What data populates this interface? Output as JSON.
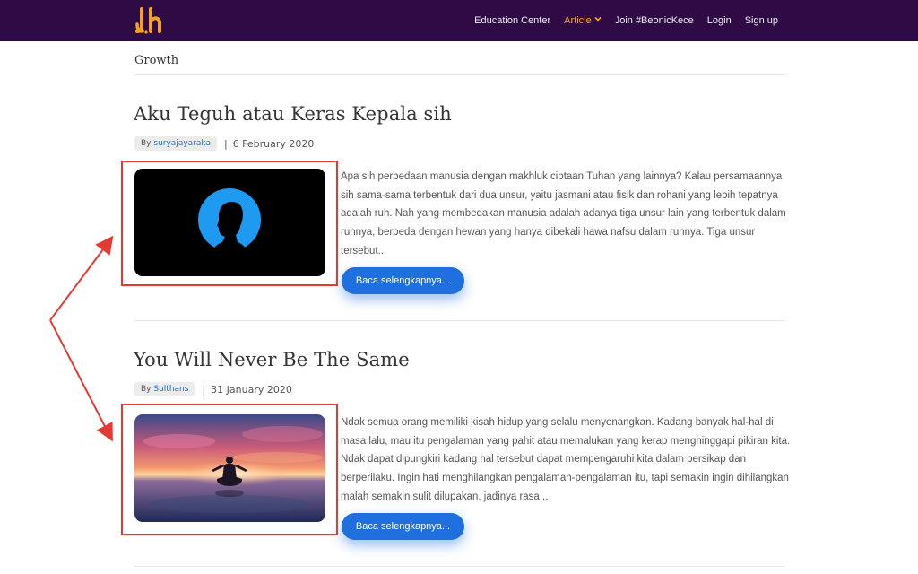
{
  "navbar": {
    "logo_text": "Jh",
    "links": [
      {
        "label": "Education Center"
      },
      {
        "label": "Article"
      },
      {
        "label": "Join #BeonicKece"
      },
      {
        "label": "Login"
      },
      {
        "label": "Sign up"
      }
    ],
    "colors": {
      "background": "#2f0b45",
      "active": "#f6a21e"
    }
  },
  "category": "Growth",
  "posts": [
    {
      "title": "Aku Teguh atau Keras Kepala sih",
      "by_label": "By",
      "author": "suryajayaraka",
      "separator": "|",
      "date": "6 February 2020",
      "image_icon": "person-silhouette-icon",
      "excerpt": "Apa sih perbedaan manusia dengan makhluk ciptaan Tuhan yang lainnya? Kalau persamaannya sih sama-sama terbentuk dari dua unsur, yaitu jasmani atau fisik dan rohani yang lebih tepatnya adalah ruh. Nah yang membedakan manusia adalah adanya tiga unsur lain yang terbentuk dalam ruhnya, berbeda dengan hewan yang hanya dibekali hawa nafsu dalam ruhnya. Tiga unsur tersebut...",
      "button_label": "Baca selengkapnya..."
    },
    {
      "title": "You Will Never Be The Same",
      "by_label": "By",
      "author": "Sulthans",
      "separator": "|",
      "date": "31 January 2020",
      "image_icon": "meditation-sunset-icon",
      "excerpt": "Ndak semua orang memiliki kisah hidup yang selalu menyenangkan. Kadang banyak hal-hal di masa lalu, mau itu pengalaman yang pahit atau memalukan yang kerap menghinggapi pikiran kita. Ndak dapat dipungkiri kadang hal tersebut dapat mempengaruhi kita dalam bersikap dan berperilaku. Ingin hati menghilangkan pengalaman-pengalaman itu, tapi semakin ingin dihilangkan malah semakin sulit dilupakan. jadinya rasa...",
      "button_label": "Baca selengkapnya..."
    }
  ],
  "annotation": {
    "color": "#e53a32"
  }
}
